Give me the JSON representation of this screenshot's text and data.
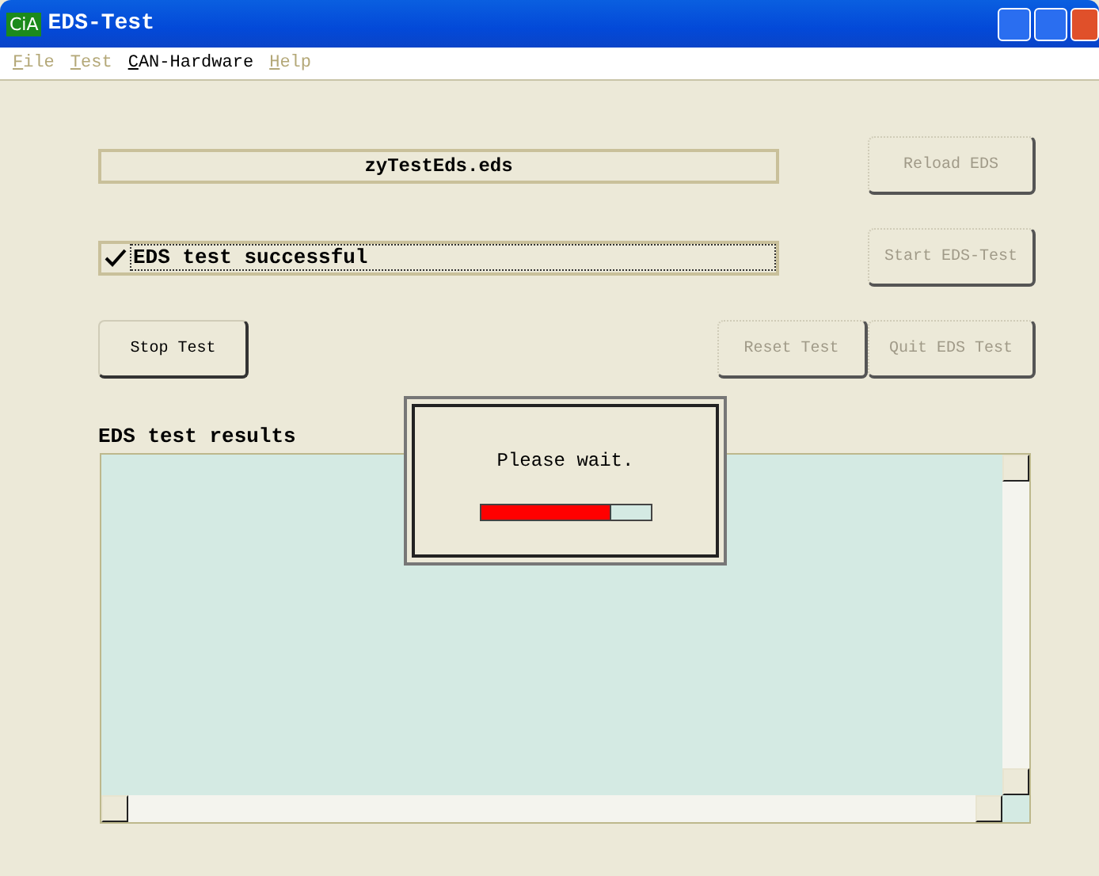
{
  "window": {
    "title": "EDS-Test",
    "logo": "CiA"
  },
  "menu": [
    {
      "label": "File",
      "disabled": true
    },
    {
      "label": "Test",
      "disabled": true
    },
    {
      "label": "CAN-Hardware",
      "disabled": false
    },
    {
      "label": "Help",
      "disabled": true
    }
  ],
  "file_field": {
    "value": "zyTestEds.eds"
  },
  "status": {
    "label": "EDS test successful",
    "checked": true
  },
  "buttons": [
    {
      "label": "Reload EDS",
      "disabled": true
    },
    {
      "label": "Start EDS-Test",
      "disabled": true
    },
    {
      "label": "Stop Test",
      "disabled": false
    },
    {
      "label": "Reset Test",
      "disabled": true
    },
    {
      "label": "Quit EDS Test",
      "disabled": true
    }
  ],
  "results": {
    "label": "EDS test results"
  },
  "dialog": {
    "message": "Please wait.",
    "level": 0.77
  }
}
